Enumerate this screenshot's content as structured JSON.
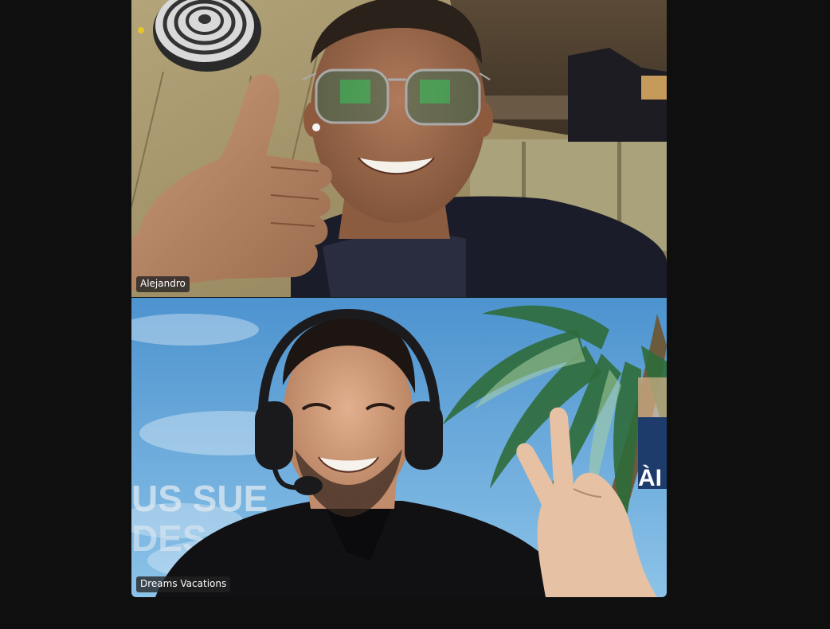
{
  "meeting": {
    "participants": [
      {
        "name": "Alejandro"
      },
      {
        "name": "Dreams Vacations"
      }
    ]
  },
  "backdrop": {
    "mirrored_text_1": "US SUE",
    "mirrored_text_2": "DES",
    "sign_text": "ÀI"
  },
  "colors": {
    "app_background": "#0f0f10",
    "name_tag_background": "#232323",
    "name_tag_text": "#ffffff",
    "sky_blue": "#5fa7dc"
  }
}
